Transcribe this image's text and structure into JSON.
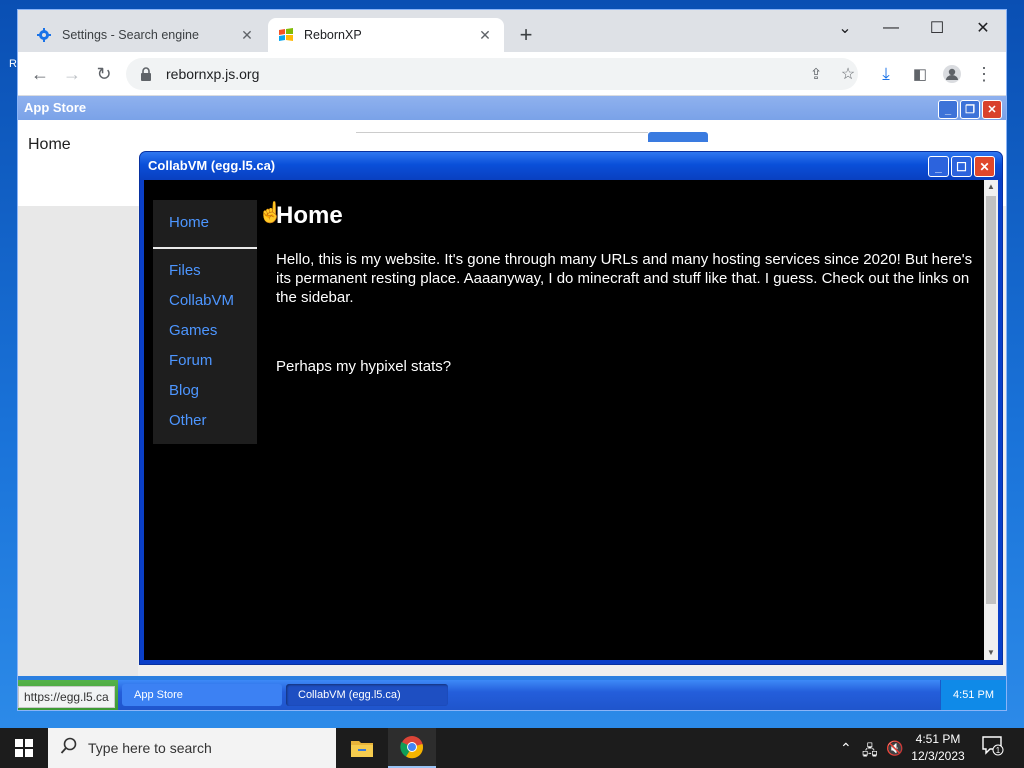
{
  "desktop": {
    "edge_label": "R"
  },
  "browser": {
    "tabs": [
      {
        "title": "Settings - Search engine",
        "icon": "gear-icon"
      },
      {
        "title": "RebornXP",
        "icon": "windows-flag-icon"
      }
    ],
    "url": "rebornxp.js.org",
    "status_url": "https://egg.l5.ca"
  },
  "appstore": {
    "title": "App Store",
    "home_label": "Home"
  },
  "collabvm": {
    "title": "CollabVM (egg.l5.ca)",
    "nav": [
      "Home",
      "Files",
      "CollabVM",
      "Games",
      "Forum",
      "Blog",
      "Other"
    ],
    "heading": "Home",
    "paragraph": "Hello, this is my website. It's gone through many URLs and many hosting services since 2020! But here's its permanent resting place. Aaaanyway, I do minecraft and stuff like that. I guess. Check out the links on the sidebar.",
    "paragraph2": "Perhaps my hypixel stats?"
  },
  "xp_taskbar": {
    "tasks": [
      "App Store",
      "CollabVM (egg.l5.ca)"
    ],
    "clock": "4:51 PM"
  },
  "windows_taskbar": {
    "search_placeholder": "Type here to search",
    "time": "4:51 PM",
    "date": "12/3/2023",
    "notification_count": "1"
  },
  "colors": {
    "link_blue": "#4d96ff",
    "xp_title_blue": "#0a4fd9",
    "close_red": "#e0472a"
  }
}
